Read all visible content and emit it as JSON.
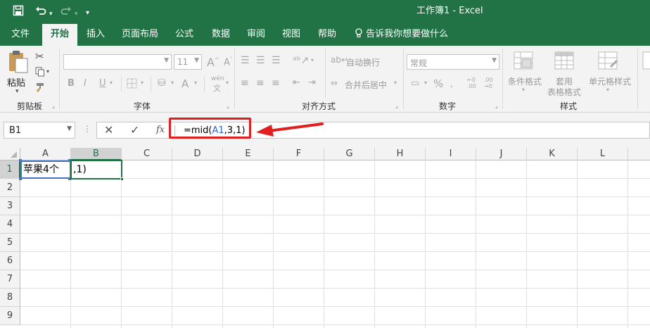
{
  "app": {
    "window_title": "工作簿1  -  Excel",
    "accent_color": "#217346",
    "annotation_color": "#e02020"
  },
  "quick_access": {
    "save_icon": "save-icon",
    "undo_icon": "undo-icon",
    "redo_icon": "redo-icon",
    "customize_icon": "chevron-down-icon"
  },
  "tabs": [
    {
      "label": "文件"
    },
    {
      "label": "开始",
      "active": true
    },
    {
      "label": "插入"
    },
    {
      "label": "页面布局"
    },
    {
      "label": "公式"
    },
    {
      "label": "数据"
    },
    {
      "label": "审阅"
    },
    {
      "label": "视图"
    },
    {
      "label": "帮助"
    }
  ],
  "tell_me": "告诉我你想要做什么",
  "ribbon": {
    "clipboard": {
      "paste_label": "粘贴",
      "group_label": "剪贴板"
    },
    "font": {
      "font_name": "",
      "font_size": "11",
      "group_label": "字体",
      "bold": "B",
      "italic": "I",
      "underline": "U",
      "phonetic": "wén"
    },
    "alignment": {
      "wrap_text": "自动换行",
      "merge_center": "合并后居中",
      "group_label": "对齐方式"
    },
    "number": {
      "format": "常规",
      "percent": "%",
      "group_label": "数字"
    },
    "styles": {
      "conditional": "条件格式",
      "table_format_1": "套用",
      "table_format_2": "表格格式",
      "cell_styles": "单元格样式",
      "group_label": "样式"
    }
  },
  "formula_bar": {
    "name_box": "B1",
    "fx_label": "fx",
    "formula_prefix": "=mid(",
    "formula_ref": "A1",
    "formula_suffix": ",3,1)"
  },
  "sheet": {
    "columns": [
      "A",
      "B",
      "C",
      "D",
      "E",
      "F",
      "G",
      "H",
      "I",
      "J",
      "K",
      "L"
    ],
    "selected_column": "B",
    "rows": [
      "1",
      "2",
      "3",
      "4",
      "5",
      "6",
      "7",
      "8",
      "9"
    ],
    "cells": {
      "A1": "苹果4个",
      "B1": ",1)"
    }
  }
}
